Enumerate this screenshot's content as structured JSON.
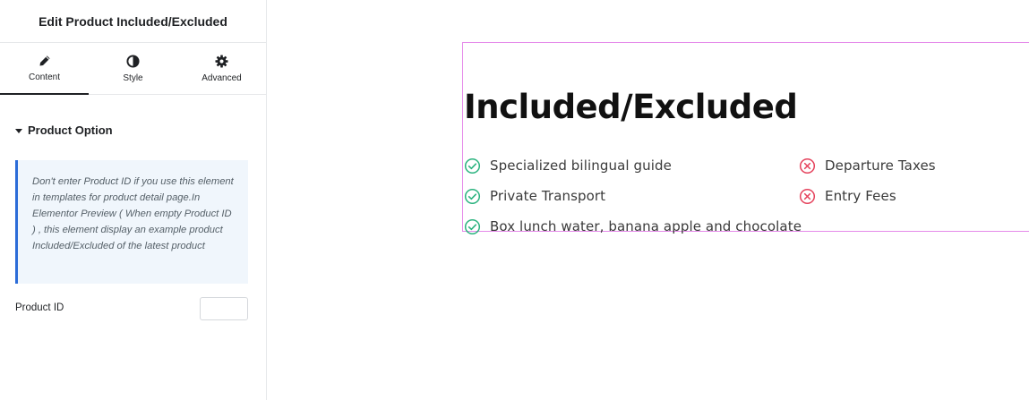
{
  "panel": {
    "title": "Edit Product Included/Excluded",
    "tabs": [
      {
        "label": "Content",
        "icon": "pencil-icon"
      },
      {
        "label": "Style",
        "icon": "half-circle-icon"
      },
      {
        "label": "Advanced",
        "icon": "gear-icon"
      }
    ],
    "section_title": "Product Option",
    "notice": "Don't enter Product ID if you use this element in templates for product detail page.In Elementor Preview ( When empty Product ID ) , this element display an example product Included/Excluded of the latest product",
    "product_id_label": "Product ID",
    "product_id_value": ""
  },
  "preview": {
    "heading": "Included/Excluded",
    "included": [
      "Specialized bilingual guide",
      "Private Transport",
      "Box lunch water, banana apple and chocolate"
    ],
    "excluded": [
      "Departure Taxes",
      "Entry Fees"
    ]
  },
  "colors": {
    "included_icon": "#2bb37f",
    "excluded_icon": "#e5425c",
    "notice_border": "#2b6cd8",
    "widget_outline": "#e58bea"
  }
}
